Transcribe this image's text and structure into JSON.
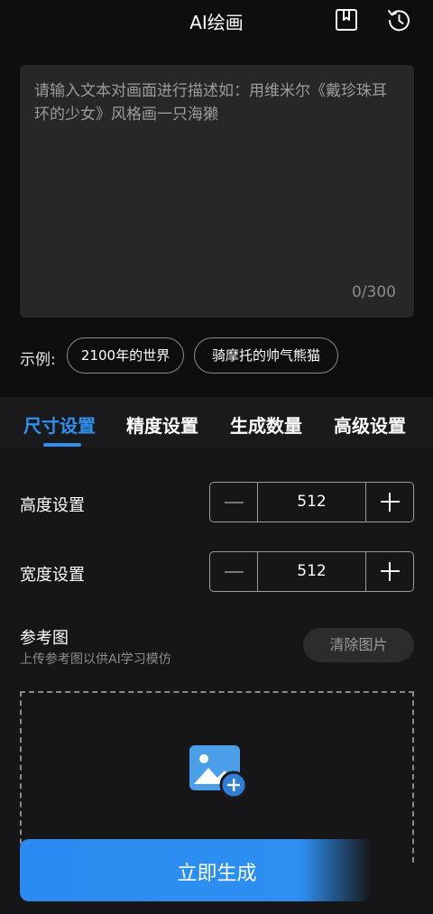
{
  "header": {
    "title": "AI绘画",
    "bookmark_icon": "bookmark-icon",
    "history_icon": "history-icon"
  },
  "prompt": {
    "placeholder": "请输入文本对画面进行描述如：用维米尔《戴珍珠耳环的少女》风格画一只海獭",
    "counter": "0/300"
  },
  "examples": {
    "label": "示例:",
    "chips": [
      "2100年的世界",
      "骑摩托的帅气熊猫"
    ]
  },
  "tabs": [
    {
      "label": "尺寸设置",
      "active": true
    },
    {
      "label": "精度设置",
      "active": false
    },
    {
      "label": "生成数量",
      "active": false
    },
    {
      "label": "高级设置",
      "active": false
    }
  ],
  "size": {
    "height_label": "高度设置",
    "height_value": "512",
    "width_label": "宽度设置",
    "width_value": "512"
  },
  "reference": {
    "title": "参考图",
    "subtitle": "上传参考图以供AI学习模仿",
    "clear_label": "清除图片",
    "upload_icon": "add-image-icon"
  },
  "generate_label": "立即生成",
  "colors": {
    "accent": "#2f90ee",
    "background": "#0e0e0f"
  }
}
